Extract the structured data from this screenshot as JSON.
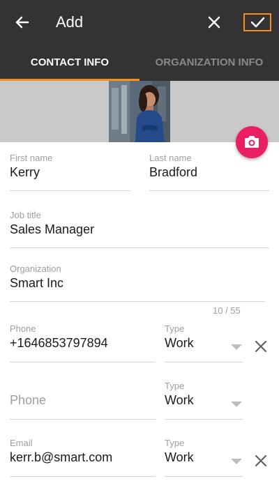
{
  "header": {
    "title": "Add"
  },
  "tabs": [
    {
      "label": "CONTACT INFO",
      "active": true
    },
    {
      "label": "ORGANIZATION INFO",
      "active": false
    }
  ],
  "colors": {
    "accent": "#f5901e",
    "appbar": "#333333",
    "fab": "#e91e63"
  },
  "icons": {
    "back": "arrow-left",
    "close": "x",
    "save": "check",
    "camera": "camera"
  },
  "form": {
    "first_name": {
      "label": "First name",
      "value": "Kerry"
    },
    "last_name": {
      "label": "Last name",
      "value": "Bradford"
    },
    "job_title": {
      "label": "Job title",
      "value": "Sales Manager"
    },
    "organization": {
      "label": "Organization",
      "value": "Smart Inc",
      "counter": "10 / 55"
    },
    "phones": [
      {
        "label": "Phone",
        "value": "+1646853797894",
        "type_label": "Type",
        "type": "Work"
      },
      {
        "placeholder": "Phone",
        "type_label": "Type",
        "type": "Work"
      }
    ],
    "email": {
      "label": "Email",
      "value": "kerr.b@smart.com",
      "type_label": "Type",
      "type": "Work"
    }
  }
}
